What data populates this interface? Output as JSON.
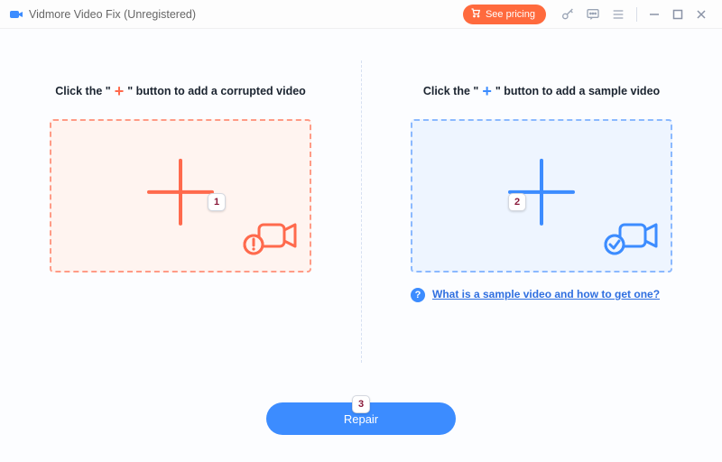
{
  "app": {
    "title": "Vidmore Video Fix (Unregistered)"
  },
  "titlebar": {
    "pricing_label": "See pricing"
  },
  "left": {
    "instruction_pre": "Click the \"",
    "instruction_plus": "+",
    "instruction_post": "\" button to add a corrupted video"
  },
  "right": {
    "instruction_pre": "Click the \"",
    "instruction_plus": "+",
    "instruction_post": "\" button to add a sample video",
    "help_text": "What is a sample video and how to get one?",
    "help_q": "?"
  },
  "repair": {
    "label": "Repair"
  },
  "badges": {
    "one": "1",
    "two": "2",
    "three": "3"
  }
}
